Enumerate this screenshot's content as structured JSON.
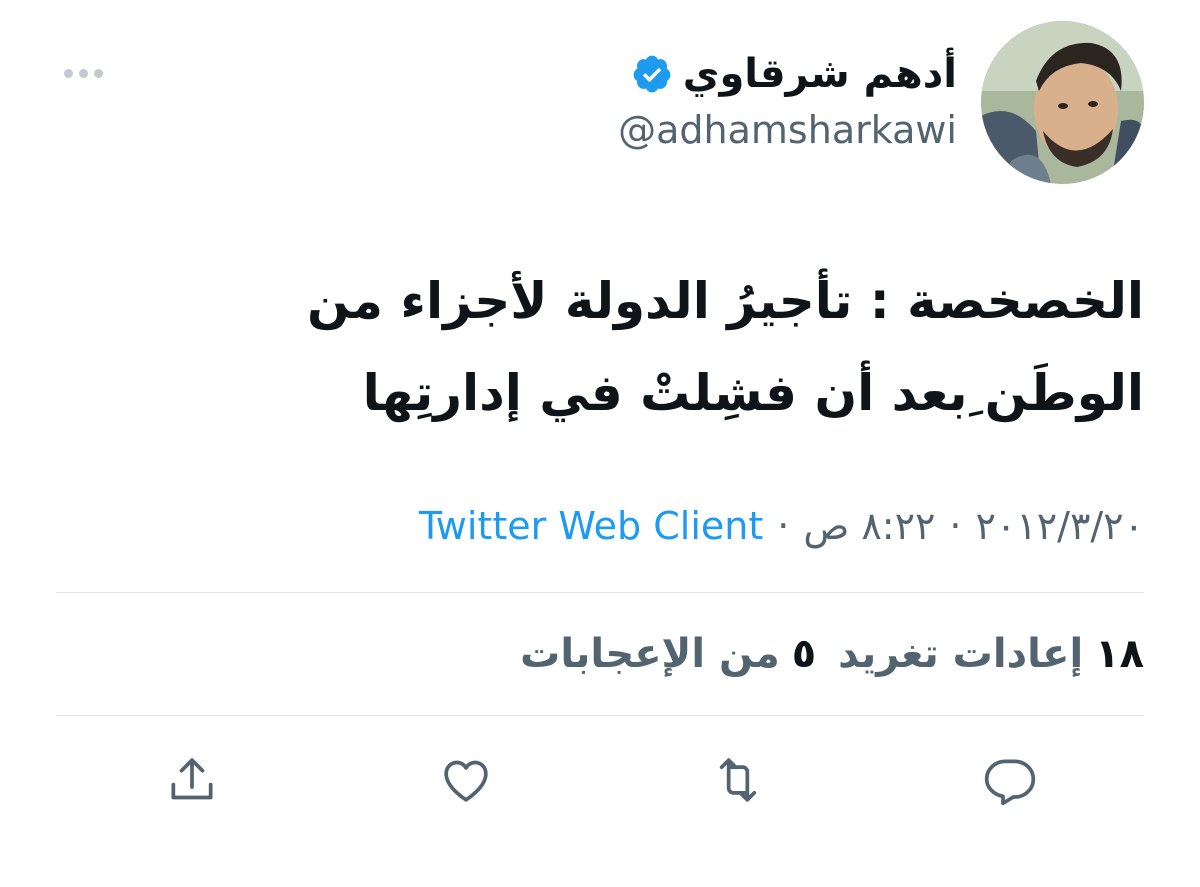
{
  "author": {
    "display_name": "أدهم شرقاوي",
    "handle": "@adhamsharkawi",
    "verified": true
  },
  "tweet": {
    "text": "الخصخصة : تأجيرُ الدولة لأجزاء من الوطَن ِبعد أن فشِلتْ في إدارتِها"
  },
  "meta": {
    "date": "٢٠١٢/٣/٢٠",
    "separator": "·",
    "time": "٨:٢٢ ص",
    "source": "Twitter Web Client"
  },
  "stats": {
    "retweets_count": "١٨",
    "retweets_label": "إعادات تغريد",
    "likes_count": "٥",
    "likes_label": "من الإعجابات"
  },
  "icons": {
    "more": "more-dots-icon",
    "verified": "verified-badge-icon",
    "reply": "reply-icon",
    "retweet": "retweet-icon",
    "like": "like-heart-icon",
    "share": "share-icon"
  },
  "colors": {
    "accent": "#1d9bf0",
    "text_primary": "#0f1419",
    "text_secondary": "#536471",
    "divider": "#dde2e6"
  }
}
